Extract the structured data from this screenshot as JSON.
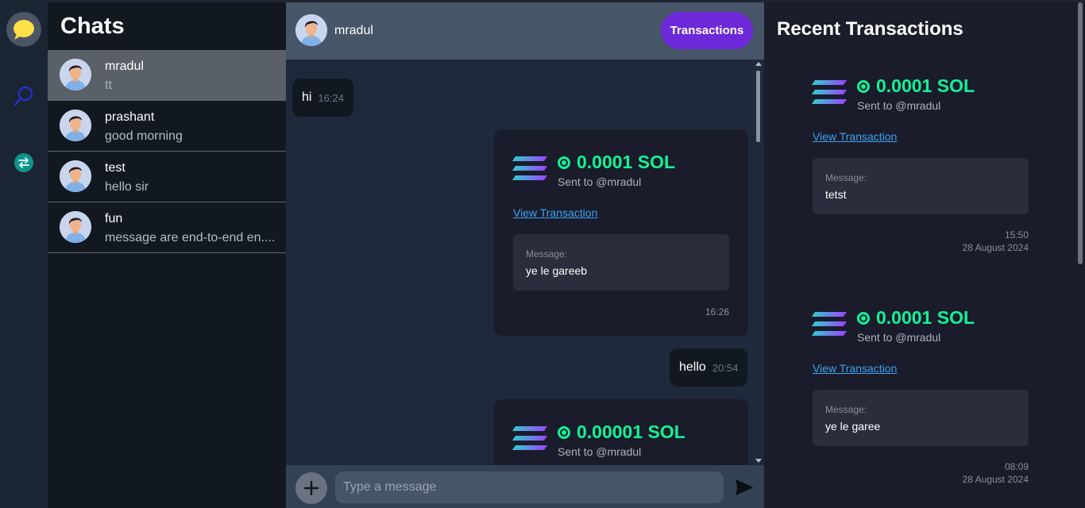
{
  "sidebar": {
    "title": "Chats",
    "chats": [
      {
        "name": "mradul",
        "last_message": "tt"
      },
      {
        "name": "prashant",
        "last_message": "good morning"
      },
      {
        "name": "test",
        "last_message": "hello sir"
      },
      {
        "name": "fun",
        "last_message": "message are end-to-end en...."
      }
    ]
  },
  "header": {
    "contact_name": "mradul",
    "transactions_label": "Transactions"
  },
  "messages": {
    "m1": {
      "text": "hi",
      "time": "16:24"
    },
    "tx1": {
      "amount": "0.0001 SOL",
      "sent_to": "Sent to @mradul",
      "link": "View Transaction",
      "message_label": "Message:",
      "message": "ye le gareeb",
      "time": "16:26"
    },
    "m2": {
      "text": "hello",
      "time": "20:54"
    },
    "tx2": {
      "amount": "0.00001 SOL",
      "sent_to": "Sent to @mradul"
    }
  },
  "composer": {
    "placeholder": "Type a message"
  },
  "recent": {
    "title": "Recent Transactions",
    "items": [
      {
        "amount": "0.0001 SOL",
        "sent_to": "Sent to @mradul",
        "link": "View Transaction",
        "message_label": "Message:",
        "message": "tetst",
        "time": "15:50",
        "date": "28 August 2024"
      },
      {
        "amount": "0.0001 SOL",
        "sent_to": "Sent to @mradul",
        "link": "View Transaction",
        "message_label": "Message:",
        "message": "ye le garee",
        "time": "08:09",
        "date": "28 August 2024"
      }
    ]
  },
  "colors": {
    "accent": "#6d28d9",
    "sol_green": "#14f195",
    "link": "#3ba4f2"
  }
}
